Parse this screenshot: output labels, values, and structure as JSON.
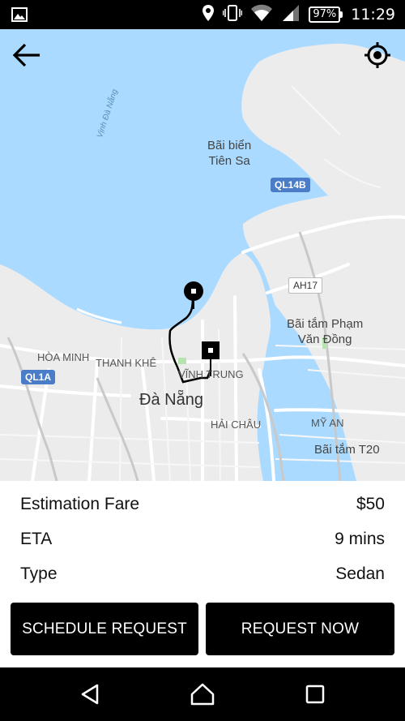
{
  "status_bar": {
    "battery": "97%",
    "time": "11:29",
    "icons": [
      "image-icon",
      "location-icon",
      "vibrate-icon",
      "wifi-icon",
      "signal-icon",
      "battery-icon"
    ]
  },
  "map": {
    "labels": {
      "vinh_da_nang": "Vịnh Đà Nẵng",
      "bai_bien_tien_sa_1": "Bãi biển",
      "bai_bien_tien_sa_2": "Tiên Sa",
      "ql14b": "QL14B",
      "ah17": "AH17",
      "bai_tam_pham_1": "Bãi tắm Phạm",
      "bai_tam_pham_2": "Văn Đồng",
      "hoa_minh": "HÒA MINH",
      "thanh_khe": "THANH KHÊ",
      "ql1a": "QL1A",
      "vinh_trung": "VĨNH TRUNG",
      "da_nang": "Đà Nẵng",
      "hai_chau": "HẢI CHÂU",
      "my_an": "MỸ AN",
      "bai_tam_t20": "Bãi tắm T20"
    },
    "colors": {
      "water": "#aadaff",
      "land": "#ececec",
      "road": "#ffffff",
      "route": "#000000"
    }
  },
  "trip": {
    "fare_label": "Estimation Fare",
    "fare_value": "$50",
    "eta_label": "ETA",
    "eta_value": "9 mins",
    "type_label": "Type",
    "type_value": "Sedan"
  },
  "actions": {
    "schedule_label": "SCHEDULE REQUEST",
    "request_label": "REQUEST NOW"
  },
  "nav": {
    "icons": [
      "back-triangle-icon",
      "home-icon",
      "recents-icon"
    ]
  }
}
